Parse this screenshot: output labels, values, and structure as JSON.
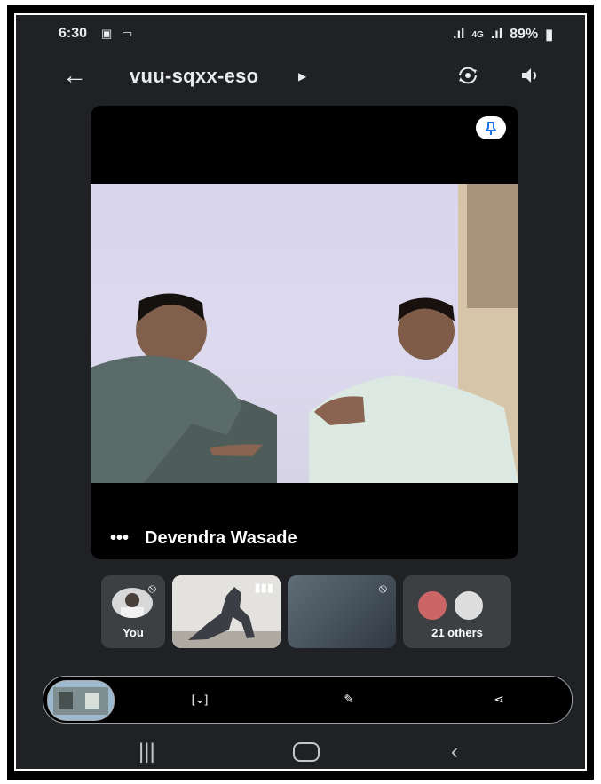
{
  "status": {
    "time": "6:30",
    "battery": "89%"
  },
  "meeting": {
    "code": "vuu-sqxx-eso"
  },
  "stage": {
    "participant_name": "Devendra Wasade",
    "more": "•••"
  },
  "tiles": [
    {
      "label": "You"
    },
    {
      "label": ""
    },
    {
      "label": ""
    },
    {
      "label": "21 others"
    }
  ],
  "icons": [
    "back-arrow-icon",
    "camera-switch-icon",
    "speaker-icon",
    "pin-icon",
    "mic-off-icon",
    "screen-share-icon",
    "crop-edit-icon",
    "share-icon"
  ],
  "colors": {
    "background": "#202124",
    "control_bg": "#000000",
    "accent": "#1a73e8"
  }
}
